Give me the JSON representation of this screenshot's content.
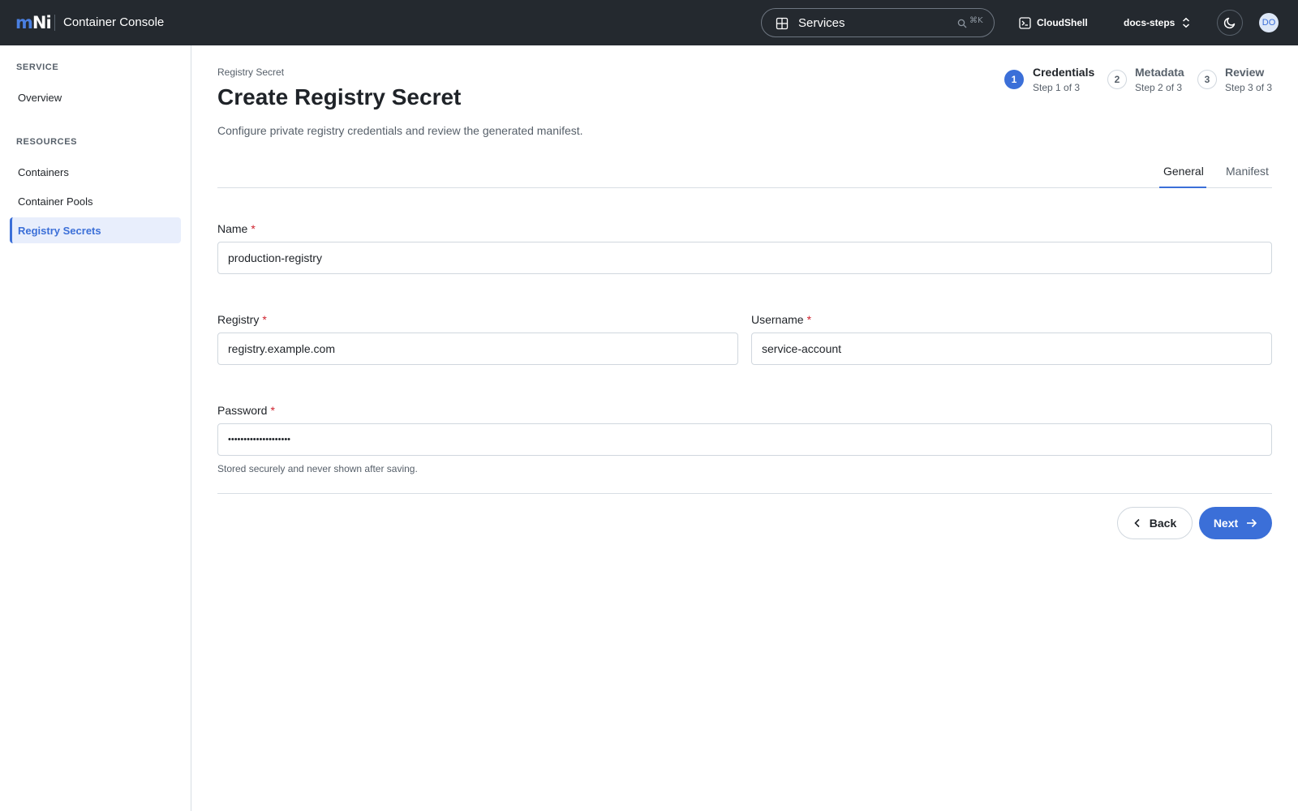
{
  "topbar": {
    "logo": {
      "part1": "m",
      "part2": "Ni"
    },
    "app_title": "Container Console",
    "search": {
      "label": "Services",
      "shortcut": "⌘K"
    },
    "cloudshell_label": "CloudShell",
    "project_label": "docs-steps",
    "avatar_initials": "DO"
  },
  "sidebar": {
    "sections": [
      {
        "heading": "SERVICE",
        "items": [
          {
            "label": "Overview",
            "active": false
          }
        ]
      },
      {
        "heading": "RESOURCES",
        "items": [
          {
            "label": "Containers",
            "active": false
          },
          {
            "label": "Container Pools",
            "active": false
          },
          {
            "label": "Registry Secrets",
            "active": true
          }
        ]
      }
    ]
  },
  "page": {
    "breadcrumb": "Registry Secret",
    "title": "Create Registry Secret",
    "subtitle": "Configure private registry credentials and review the generated manifest."
  },
  "stepper": {
    "steps": [
      {
        "number": "1",
        "title": "Credentials",
        "subtitle": "Step 1 of 3",
        "state": "active"
      },
      {
        "number": "2",
        "title": "Metadata",
        "subtitle": "Step 2 of 3",
        "state": "todo"
      },
      {
        "number": "3",
        "title": "Review",
        "subtitle": "Step 3 of 3",
        "state": "todo"
      }
    ]
  },
  "tabs": [
    {
      "label": "General",
      "active": true
    },
    {
      "label": "Manifest",
      "active": false
    }
  ],
  "form": {
    "required_marker": "*",
    "name": {
      "label": "Name",
      "value": "production-registry"
    },
    "registry": {
      "label": "Registry",
      "value": "registry.example.com"
    },
    "username": {
      "label": "Username",
      "value": "service-account"
    },
    "password": {
      "label": "Password",
      "value": "••••••••••••••••••••",
      "helper": "Stored securely and never shown after saving."
    }
  },
  "actions": {
    "back_label": "Back",
    "next_label": "Next"
  },
  "colors": {
    "accent": "#3b6fd8",
    "topbar_bg": "#24292f",
    "required": "#cf222e"
  },
  "icons": {
    "search_type": "grid-icon",
    "search": "search-icon",
    "cloudshell": "terminal-icon",
    "project": "chevron-up-down-icon",
    "theme": "moon-icon",
    "back": "chevron-left-icon",
    "next": "arrow-right-icon"
  }
}
